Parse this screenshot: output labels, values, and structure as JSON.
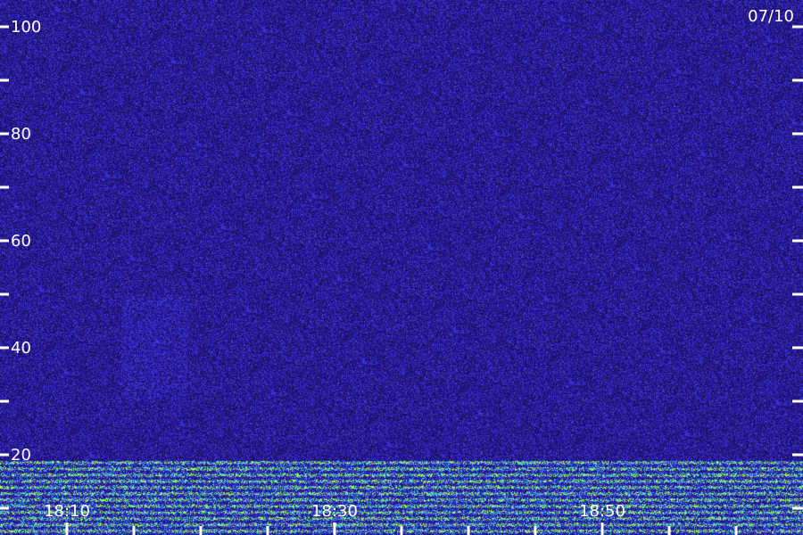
{
  "chart_data": {
    "type": "heatmap",
    "title": "",
    "date_label": "07/10",
    "y_ticks": [
      {
        "value": 100,
        "label": "100"
      },
      {
        "value": 80,
        "label": "80"
      },
      {
        "value": 60,
        "label": "60"
      },
      {
        "value": 40,
        "label": "40"
      },
      {
        "value": 20,
        "label": "20"
      }
    ],
    "y_minor_ticks": [
      90,
      70,
      50,
      30,
      10
    ],
    "ylim": [
      10,
      100
    ],
    "x_ticks": [
      {
        "value": "18:10",
        "label": "18:10"
      },
      {
        "value": "18:30",
        "label": "18:30"
      },
      {
        "value": "18:50",
        "label": "18:50"
      }
    ],
    "x_minor_ticks": [
      "18:05",
      "18:15",
      "18:20",
      "18:25",
      "18:35",
      "18:40",
      "18:45",
      "18:55",
      "19:00"
    ],
    "xlim": [
      "18:00",
      "19:00"
    ],
    "colors": {
      "background": "#1a0f5a",
      "low": "#2a1aa0",
      "mid": "#3a3ae0",
      "high": "#30c0e0",
      "peak": "#a0ff40",
      "axis": "#ffffff"
    },
    "features": [
      {
        "name": "low-band-activity",
        "y_range": [
          10,
          19
        ],
        "intensity": "high"
      },
      {
        "name": "faint-column",
        "x_range": [
          "18:14",
          "18:19"
        ],
        "y_range": [
          30,
          50
        ],
        "intensity": "low"
      }
    ]
  }
}
